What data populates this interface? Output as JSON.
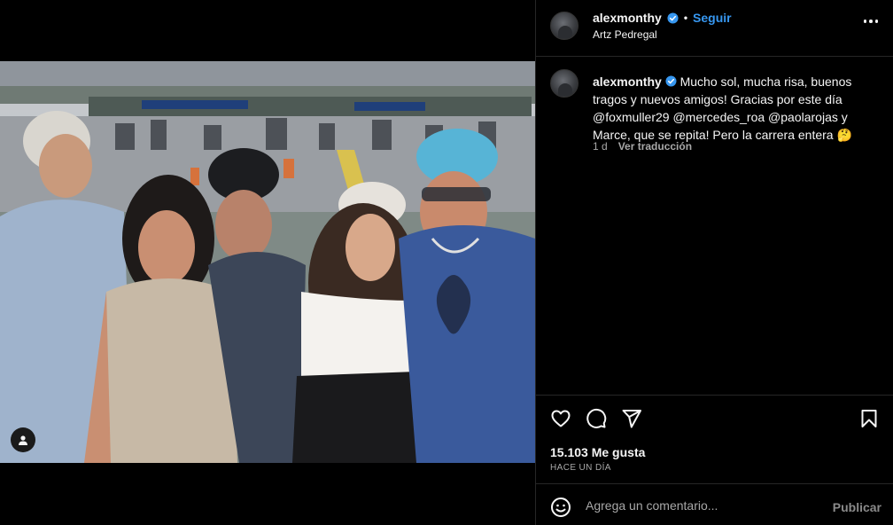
{
  "post": {
    "username": "alexmonthy",
    "follow_label": "Seguir",
    "location": "Artz Pedregal",
    "caption_text": "Mucho sol, mucha risa, buenos tragos y nuevos amigos! Gracias por este día @foxmuller29 @mercedes_roa @paolarojas y Marce, que se repita! Pero la carrera entera 🤔",
    "time_ago": "1 d",
    "translate_label": "Ver traducción",
    "likes": "15.103 Me gusta",
    "posted": "HACE UN DÍA"
  },
  "comment_box": {
    "placeholder": "Agrega un comentario...",
    "publish_label": "Publicar"
  },
  "icons": {
    "like": "heart-icon",
    "comment": "comment-icon",
    "share": "share-icon",
    "save": "bookmark-icon",
    "emoji": "emoji-icon",
    "more": "more-options-icon",
    "verified": "verified-badge-icon",
    "tagged_user": "user-tag-icon"
  },
  "colors": {
    "accent": "#3797f0",
    "background": "#000000",
    "border": "#262626",
    "muted_text": "#a8a8a8"
  }
}
